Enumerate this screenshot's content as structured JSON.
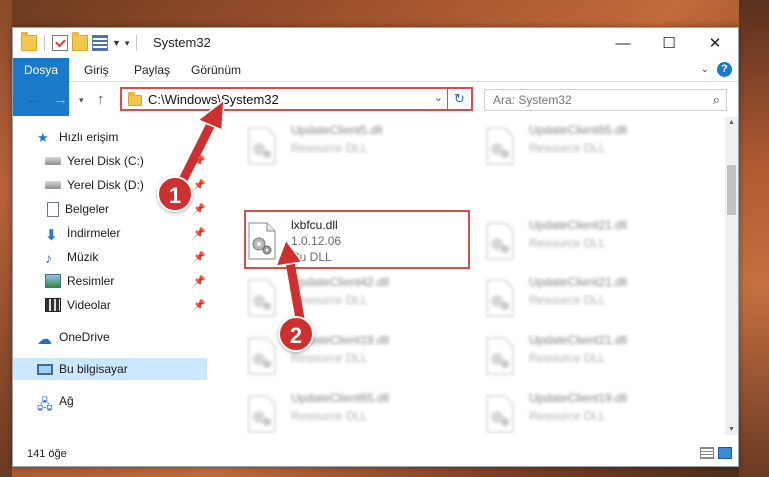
{
  "window": {
    "title": "System32",
    "controls": {
      "minimize": "—",
      "maximize": "☐",
      "close": "✕"
    }
  },
  "ribbon": {
    "tabs": [
      "Dosya",
      "Giriş",
      "Paylaş",
      "Görünüm"
    ]
  },
  "address": {
    "path": "C:\\Windows\\System32",
    "refresh_symbol": "↻"
  },
  "search": {
    "placeholder": "Ara: System32"
  },
  "sidebar": {
    "items": [
      {
        "label": "Hızlı erişim",
        "icon": "star-icon"
      },
      {
        "label": "Yerel Disk (C:)",
        "icon": "drive-icon",
        "pinned": true
      },
      {
        "label": "Yerel Disk (D:)",
        "icon": "drive-icon",
        "pinned": true
      },
      {
        "label": "Belgeler",
        "icon": "document-icon",
        "pinned": true
      },
      {
        "label": "İndirmeler",
        "icon": "download-icon",
        "pinned": true
      },
      {
        "label": "Müzik",
        "icon": "music-icon",
        "pinned": true
      },
      {
        "label": "Resimler",
        "icon": "pictures-icon",
        "pinned": true
      },
      {
        "label": "Videolar",
        "icon": "video-icon",
        "pinned": true
      },
      {
        "label": "OneDrive",
        "icon": "cloud-icon"
      },
      {
        "label": "Bu bilgisayar",
        "icon": "computer-icon",
        "selected": true
      },
      {
        "label": "Ağ",
        "icon": "network-icon"
      }
    ]
  },
  "files": {
    "focused": {
      "name": "lxbfcu.dll",
      "version": "1.0.12.06",
      "type": "Cu DLL"
    },
    "left_column": [
      {
        "name": "UpdateClient5.dll",
        "type": "Resource DLL"
      },
      {
        "name": "UpdateClient42.dll",
        "type": "Resource DLL"
      },
      {
        "name": "UpdateClient19.dll",
        "type": "Resource DLL"
      },
      {
        "name": "UpdateClient65.dll",
        "type": "Resource DLL"
      }
    ],
    "right_column": [
      {
        "name": "UpdateClient65.dll",
        "type": "Resource DLL"
      },
      {
        "name": "UpdateClient21.dll",
        "type": "Resource DLL"
      },
      {
        "name": "UpdateClient21.dll",
        "type": "Resource DLL"
      },
      {
        "name": "UpdateClient21.dll",
        "type": "Resource DLL"
      },
      {
        "name": "UpdateClient19.dll",
        "type": "Resource DLL"
      }
    ]
  },
  "status": {
    "item_count": "141 öğe"
  },
  "callouts": [
    "1",
    "2"
  ],
  "colors": {
    "accent": "#1979ca",
    "highlight_red": "#d94c4c",
    "callout_red": "#ce2f2f",
    "selection": "#cce8ff"
  }
}
